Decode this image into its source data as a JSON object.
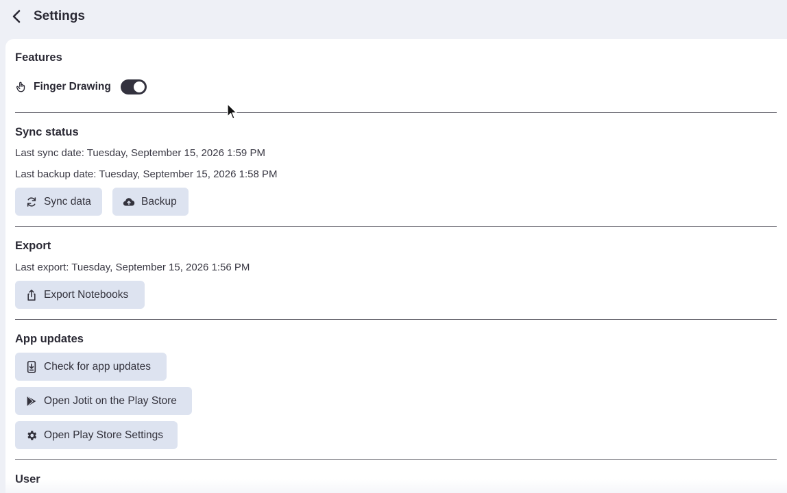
{
  "header": {
    "title": "Settings",
    "back_icon": "chevron-left-icon"
  },
  "features": {
    "title": "Features",
    "finger_drawing": {
      "icon": "hand-pointer-icon",
      "label": "Finger Drawing",
      "enabled": true
    }
  },
  "sync": {
    "title": "Sync status",
    "last_sync": "Last sync date: Tuesday, September 15, 2026 1:59 PM",
    "last_backup": "Last backup date: Tuesday, September 15, 2026 1:58 PM",
    "sync_button": {
      "label": "Sync data",
      "icon": "sync-icon"
    },
    "backup_button": {
      "label": "Backup",
      "icon": "cloud-upload-icon"
    }
  },
  "export": {
    "title": "Export",
    "last_export": "Last export: Tuesday, September 15, 2026 1:56 PM",
    "export_button": {
      "label": "Export Notebooks",
      "icon": "share-upload-icon"
    }
  },
  "app_updates": {
    "title": "App updates",
    "check_button": {
      "label": "Check for app updates",
      "icon": "phone-download-icon"
    },
    "play_store_button": {
      "label": "Open Jotit on the Play Store",
      "icon": "play-store-icon"
    },
    "play_settings_button": {
      "label": "Open Play Store Settings",
      "icon": "gear-icon"
    }
  },
  "user": {
    "title": "User"
  },
  "colors": {
    "background": "#eef0f6",
    "panel": "#ffffff",
    "button": "#dde3f0",
    "toggle_on": "#33323e",
    "text": "#2a2934"
  }
}
